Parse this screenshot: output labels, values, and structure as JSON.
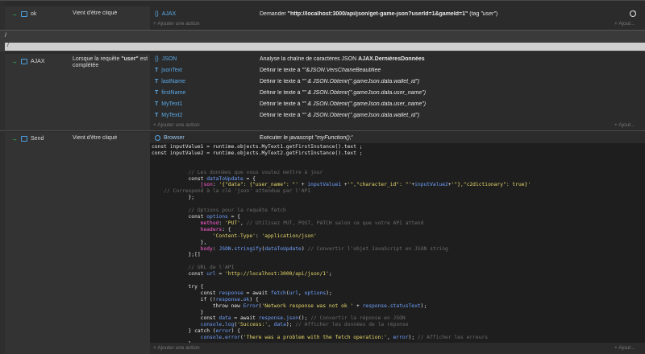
{
  "event1": {
    "trigger_object": "ok",
    "condition": "Vient d'être cliqué",
    "action": {
      "object": "AJAX",
      "desc_prefix": "Demander ",
      "desc_url": "\"http://localhost:3000/api/json/get-game-json?userId=1&gameId=1\"",
      "desc_tag": " (tag ",
      "desc_tag_value": "\"user\"",
      "desc_tag_end": ")"
    },
    "add_action": "+ Ajouter une action",
    "add_right": "+ Ajout..."
  },
  "comment1": "/",
  "comment2": "/",
  "event2": {
    "trigger_object": "AJAX",
    "condition_prefix": "Lorsque la requête ",
    "condition_tag": "\"user\"",
    "condition_suffix": " est complétée",
    "actions": [
      {
        "object": "JSON",
        "desc_plain": "Analyse la chaîne de caractères JSON ",
        "desc_bold": "AJAX.DernièresDonnées"
      },
      {
        "object": "jsonText",
        "desc_plain": "Définir le texte à ",
        "desc_italic": "\"\"&JSON.VersChaineBeautifiee"
      },
      {
        "object": "lastName",
        "desc_plain": "Définir le texte à ",
        "desc_italic": "\"\" & JSON.Obtenir(\".gameJson.data.wallet_id\")"
      },
      {
        "object": "firstName",
        "desc_plain": "Définir le texte à ",
        "desc_italic": "\"\" & JSON.Obtenir(\".gameJson.data.user_name\")"
      },
      {
        "object": "MyText1",
        "desc_plain": "Définir le texte à ",
        "desc_italic": "\"\" & JSON.Obtenir(\".gameJson.data.user_name\")"
      },
      {
        "object": "MyText2",
        "desc_plain": "Définir le texte à ",
        "desc_italic": "\"\" & JSON.Obtenir(\".gameJson.data.wallet_id\")"
      }
    ],
    "add_action": "+ Ajouter une action",
    "add_right": "+ Ajout..."
  },
  "event3": {
    "trigger_object": "Send",
    "condition": "Vient d'être cliqué",
    "action": {
      "object": "Browser",
      "desc_plain": "Exécuter le javascript ",
      "desc_italic": "\"myFunction();\""
    },
    "add_action": "+ Ajouter une action",
    "add_right": "+ Ajout..."
  },
  "code_lines": [
    [
      [
        "def",
        "const inputValue1 = runtime.objects.MyText1.getFirstInstance().text ;"
      ]
    ],
    [
      [
        "def",
        "const inputValue2 = runtime.objects.MyText2.getFirstInstance().text ;"
      ]
    ],
    [],
    [],
    [
      [
        "def",
        "            "
      ],
      [
        "cm",
        "// Les données que vous voulez mettre à jour"
      ]
    ],
    [
      [
        "def",
        "            const "
      ],
      [
        "fn",
        "dataToUpdate"
      ],
      [
        "def",
        " = {"
      ]
    ],
    [
      [
        "def",
        "                "
      ],
      [
        "mag",
        "json"
      ],
      [
        "def",
        ": "
      ],
      [
        "str",
        "'{\"data\": {\"user_name\": \"'"
      ],
      [
        "def",
        " + "
      ],
      [
        "fn",
        "inputValue1"
      ],
      [
        "def",
        " +"
      ],
      [
        "str",
        "'\",\"character_id\": \"'"
      ],
      [
        "def",
        "+"
      ],
      [
        "fn",
        "inputValue2"
      ],
      [
        "def",
        "+"
      ],
      [
        "str",
        "'\"},\"c2dictionary\": true}'"
      ]
    ],
    [
      [
        "def",
        "    "
      ],
      [
        "cm",
        "// Correspond à la clé 'json' attendue par l'API"
      ]
    ],
    [
      [
        "def",
        "            };"
      ]
    ],
    [],
    [
      [
        "def",
        "            "
      ],
      [
        "cm",
        "// Options pour la requête fetch"
      ]
    ],
    [
      [
        "def",
        "            const "
      ],
      [
        "fn",
        "options"
      ],
      [
        "def",
        " = {"
      ]
    ],
    [
      [
        "def",
        "                "
      ],
      [
        "mag",
        "method"
      ],
      [
        "def",
        ": "
      ],
      [
        "str",
        "'PUT'"
      ],
      [
        "def",
        ", "
      ],
      [
        "cm",
        "// Utilisez PUT, POST, PATCH selon ce que votre API attend"
      ]
    ],
    [
      [
        "def",
        "                "
      ],
      [
        "mag",
        "headers"
      ],
      [
        "def",
        ": {"
      ]
    ],
    [
      [
        "def",
        "                    "
      ],
      [
        "str",
        "'Content-Type'"
      ],
      [
        "def",
        ": "
      ],
      [
        "str",
        "'application/json'"
      ]
    ],
    [
      [
        "def",
        "                },"
      ]
    ],
    [
      [
        "def",
        "                "
      ],
      [
        "mag",
        "body"
      ],
      [
        "def",
        ": "
      ],
      [
        "fn",
        "JSON"
      ],
      [
        "def",
        "."
      ],
      [
        "fn",
        "stringify"
      ],
      [
        "def",
        "("
      ],
      [
        "fn",
        "dataToUpdate"
      ],
      [
        "def",
        ") "
      ],
      [
        "cm",
        "// Convertir l'objet JavaScript en JSON string"
      ]
    ],
    [
      [
        "def",
        "            };[]"
      ]
    ],
    [],
    [
      [
        "def",
        "            "
      ],
      [
        "cm",
        "// URL de l'API"
      ]
    ],
    [
      [
        "def",
        "            const "
      ],
      [
        "fn",
        "url"
      ],
      [
        "def",
        " = "
      ],
      [
        "str",
        "'http://localhost:3000/api/json/1'"
      ],
      [
        "def",
        ";"
      ]
    ],
    [],
    [
      [
        "def",
        "            try {"
      ]
    ],
    [
      [
        "def",
        "                const "
      ],
      [
        "fn",
        "response"
      ],
      [
        "def",
        " = await "
      ],
      [
        "fn",
        "fetch"
      ],
      [
        "def",
        "("
      ],
      [
        "fn",
        "url"
      ],
      [
        "def",
        ", "
      ],
      [
        "fn",
        "options"
      ],
      [
        "def",
        ");"
      ]
    ],
    [
      [
        "def",
        "                if (!"
      ],
      [
        "fn",
        "response"
      ],
      [
        "def",
        "."
      ],
      [
        "fn",
        "ok"
      ],
      [
        "def",
        ") {"
      ]
    ],
    [
      [
        "def",
        "                    throw new "
      ],
      [
        "fn",
        "Error"
      ],
      [
        "def",
        "("
      ],
      [
        "str",
        "'Network response was not ok '"
      ],
      [
        "def",
        " + "
      ],
      [
        "fn",
        "response"
      ],
      [
        "def",
        "."
      ],
      [
        "fn",
        "statusText"
      ],
      [
        "def",
        ");"
      ]
    ],
    [
      [
        "def",
        "                }"
      ]
    ],
    [
      [
        "def",
        "                const "
      ],
      [
        "fn",
        "data"
      ],
      [
        "def",
        " = await "
      ],
      [
        "fn",
        "response"
      ],
      [
        "def",
        "."
      ],
      [
        "fn",
        "json"
      ],
      [
        "def",
        "(); "
      ],
      [
        "cm",
        "// Convertir la réponse en JSON"
      ]
    ],
    [
      [
        "def",
        "                "
      ],
      [
        "fn",
        "console"
      ],
      [
        "def",
        "."
      ],
      [
        "fn",
        "log"
      ],
      [
        "def",
        "("
      ],
      [
        "str",
        "'Success:'"
      ],
      [
        "def",
        ", "
      ],
      [
        "fn",
        "data"
      ],
      [
        "def",
        "); "
      ],
      [
        "cm",
        "// Afficher les données de la réponse"
      ]
    ],
    [
      [
        "def",
        "            } catch ("
      ],
      [
        "fn",
        "error"
      ],
      [
        "def",
        ") {"
      ]
    ],
    [
      [
        "def",
        "                "
      ],
      [
        "fn",
        "console"
      ],
      [
        "def",
        "."
      ],
      [
        "fn",
        "error"
      ],
      [
        "def",
        "("
      ],
      [
        "str",
        "'There was a problem with the fetch operation:'"
      ],
      [
        "def",
        ", "
      ],
      [
        "fn",
        "error"
      ],
      [
        "def",
        "); "
      ],
      [
        "cm",
        "// Afficher les erreurs"
      ]
    ],
    [
      [
        "def",
        "            }"
      ]
    ]
  ]
}
